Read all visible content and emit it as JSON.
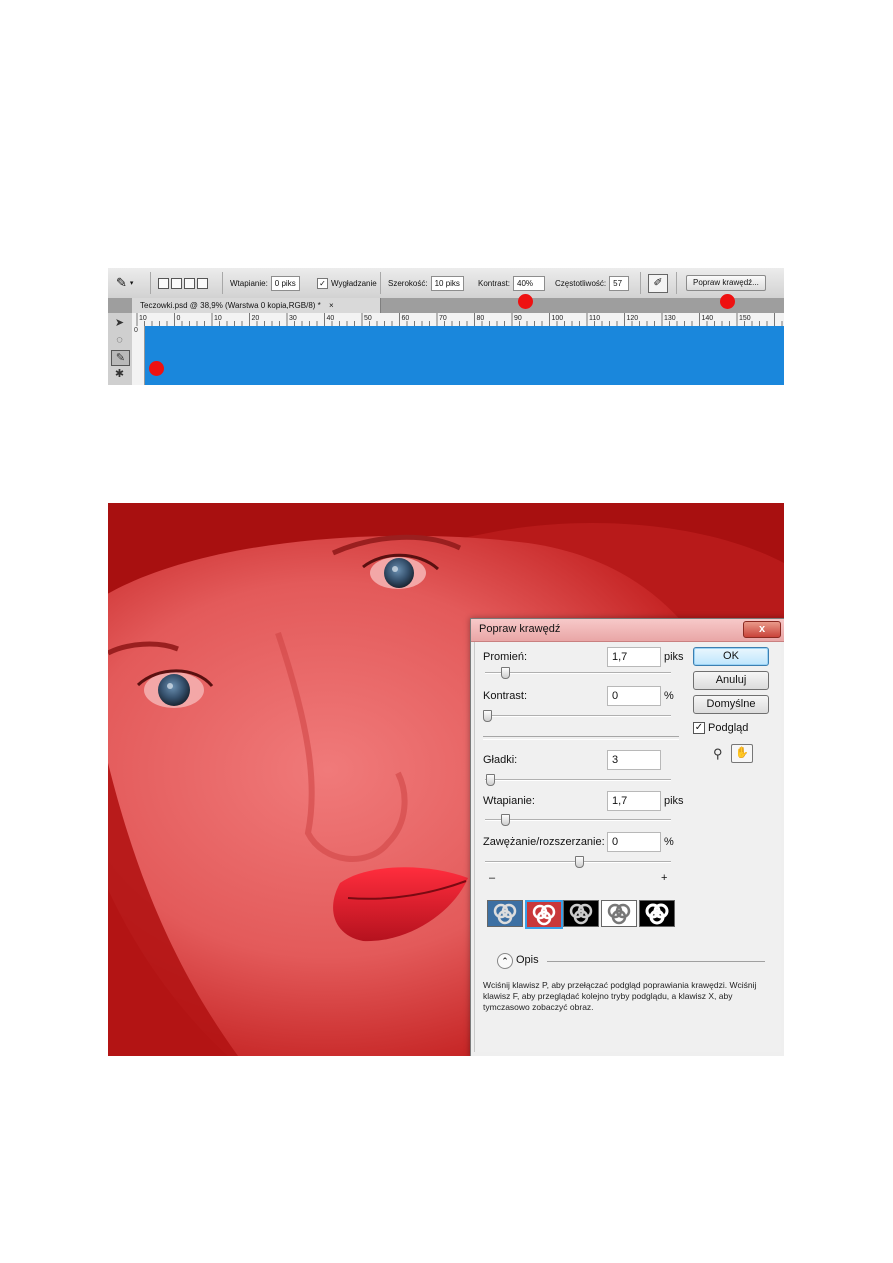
{
  "optionsBar": {
    "feather_label": "Wtapianie:",
    "feather_value": "0 piks",
    "antialias_label": "Wygładzanie",
    "antialias_checked": true,
    "width_label": "Szerokość:",
    "width_value": "10 piks",
    "contrast_label": "Kontrast:",
    "contrast_value": "40%",
    "frequency_label": "Częstotliwość:",
    "frequency_value": "57",
    "refine_button": "Popraw krawędź..."
  },
  "document": {
    "tab_title": "Teczowki.psd @ 38,9% (Warstwa 0 kopia,RGB/8) *",
    "tab_close": "×",
    "canvas_color": "#1a87dc"
  },
  "ruler": {
    "ticks": [
      "10",
      "0",
      "10",
      "20",
      "30",
      "40",
      "50",
      "60",
      "70",
      "80",
      "90",
      "100",
      "110",
      "120",
      "130",
      "140",
      "150"
    ]
  },
  "markerColor": "#ee1111",
  "dialog": {
    "title": "Popraw krawędź",
    "close_symbol": "x",
    "radius_label": "Promień:",
    "radius_value": "1,7",
    "radius_unit": "piks",
    "contrast_label": "Kontrast:",
    "contrast_value": "0",
    "contrast_unit": "%",
    "smooth_label": "Gładki:",
    "smooth_value": "3",
    "feather_label": "Wtapianie:",
    "feather_value": "1,7",
    "feather_unit": "piks",
    "contract_label": "Zawężanie/rozszerzanie:",
    "contract_value": "0",
    "contract_unit": "%",
    "minus": "–",
    "plus": "+",
    "ok_button": "OK",
    "cancel_button": "Anuluj",
    "default_button": "Domyślne",
    "preview_label": "Podgląd",
    "preview_checked": true,
    "description_label": "Opis",
    "description_text": "Wciśnij klawisz P, aby przełączać podgląd poprawiania krawędzi. Wciśnij klawisz F, aby przeglądać kolejno tryby podglądu, a klawisz X, aby tymczasowo zobaczyć obraz."
  }
}
